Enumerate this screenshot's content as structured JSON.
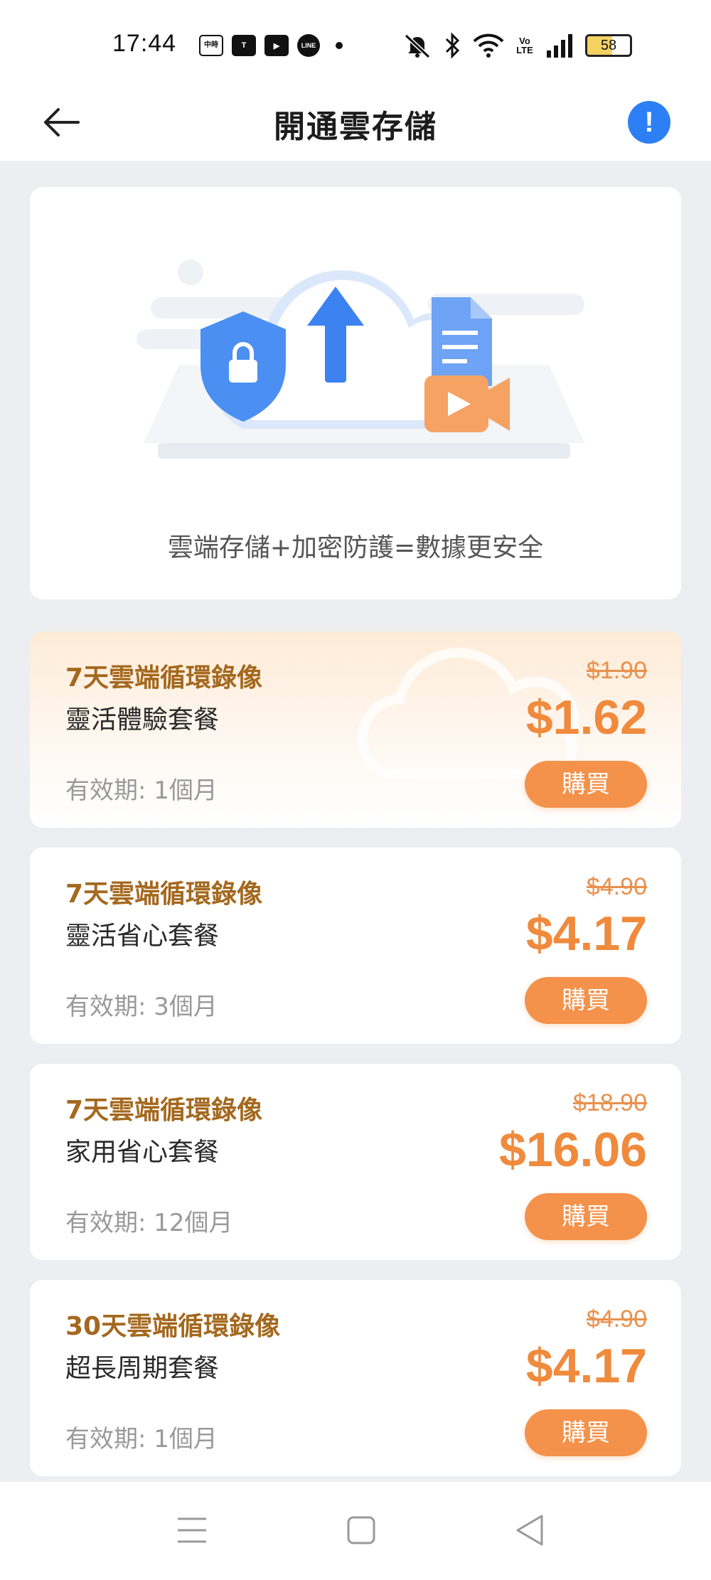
{
  "status_bar": {
    "time": "17:44",
    "battery": "58",
    "notification_icons": [
      {
        "name": "chinatimes-news-icon",
        "text": "中時"
      },
      {
        "name": "tvbs-icon",
        "text": "T"
      },
      {
        "name": "youtube-icon",
        "text": "▶"
      },
      {
        "name": "line-icon",
        "text": "LINE"
      }
    ],
    "volte": "Vo LTE"
  },
  "header": {
    "title": "開通雲存儲",
    "info_icon": "!"
  },
  "banner": {
    "caption": "雲端存儲+加密防護=數據更安全"
  },
  "plans": [
    {
      "type": "7天雲端循環錄像",
      "name": "靈活體驗套餐",
      "validity": "有效期: 1個月",
      "original_price": "$1.90",
      "price": "$1.62",
      "buy_label": "購買",
      "featured": true
    },
    {
      "type": "7天雲端循環錄像",
      "name": "靈活省心套餐",
      "validity": "有效期: 3個月",
      "original_price": "$4.90",
      "price": "$4.17",
      "buy_label": "購買",
      "featured": false
    },
    {
      "type": "7天雲端循環錄像",
      "name": "家用省心套餐",
      "validity": "有效期: 12個月",
      "original_price": "$18.90",
      "price": "$16.06",
      "buy_label": "購買",
      "featured": false
    },
    {
      "type": "30天雲端循環錄像",
      "name": "超長周期套餐",
      "validity": "有效期: 1個月",
      "original_price": "$4.90",
      "price": "$4.17",
      "buy_label": "購買",
      "featured": false
    }
  ],
  "colors": {
    "accent_orange": "#f08a3c",
    "plan_type_brown": "#a4681e",
    "info_blue": "#2d7ff5"
  }
}
